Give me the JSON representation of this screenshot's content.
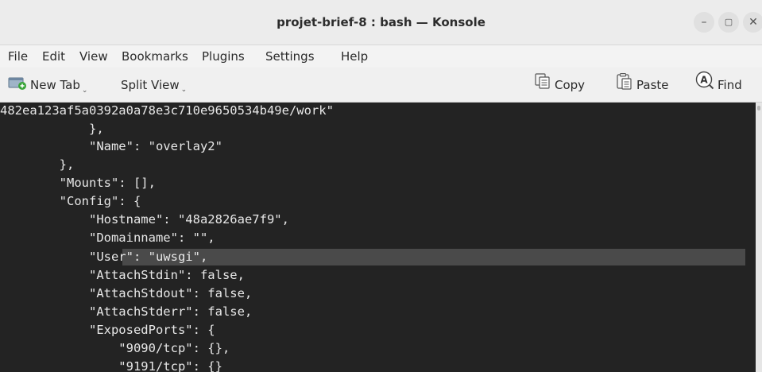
{
  "window": {
    "title": "projet-brief-8 : bash — Konsole",
    "controls": {
      "minimize": "–",
      "maximize": "▢",
      "close": "✕"
    }
  },
  "menu": {
    "items": [
      "File",
      "Edit",
      "View",
      "Bookmarks",
      "Plugins",
      "Settings",
      "Help"
    ]
  },
  "toolbar": {
    "new_tab": "New Tab",
    "split_view": "Split View",
    "copy": "Copy",
    "paste": "Paste",
    "find": "Find"
  },
  "terminal": {
    "lines": [
      "482ea123af5a0392a0a78e3c710e9650534b49e/work\"",
      "            },",
      "            \"Name\": \"overlay2\"",
      "        },",
      "        \"Mounts\": [],",
      "        \"Config\": {",
      "            \"Hostname\": \"48a2826ae7f9\",",
      "            \"Domainname\": \"\",",
      "            \"User\": \"uwsgi\",",
      "            \"AttachStdin\": false,",
      "            \"AttachStdout\": false,",
      "            \"AttachStderr\": false,",
      "            \"ExposedPorts\": {",
      "                \"9090/tcp\": {},",
      "                \"9191/tcp\": {}"
    ],
    "highlighted_line_index": 8
  },
  "colors": {
    "terminal_bg": "#232323",
    "terminal_fg": "#e8e8e8",
    "highlight": "#4a4a4a"
  }
}
